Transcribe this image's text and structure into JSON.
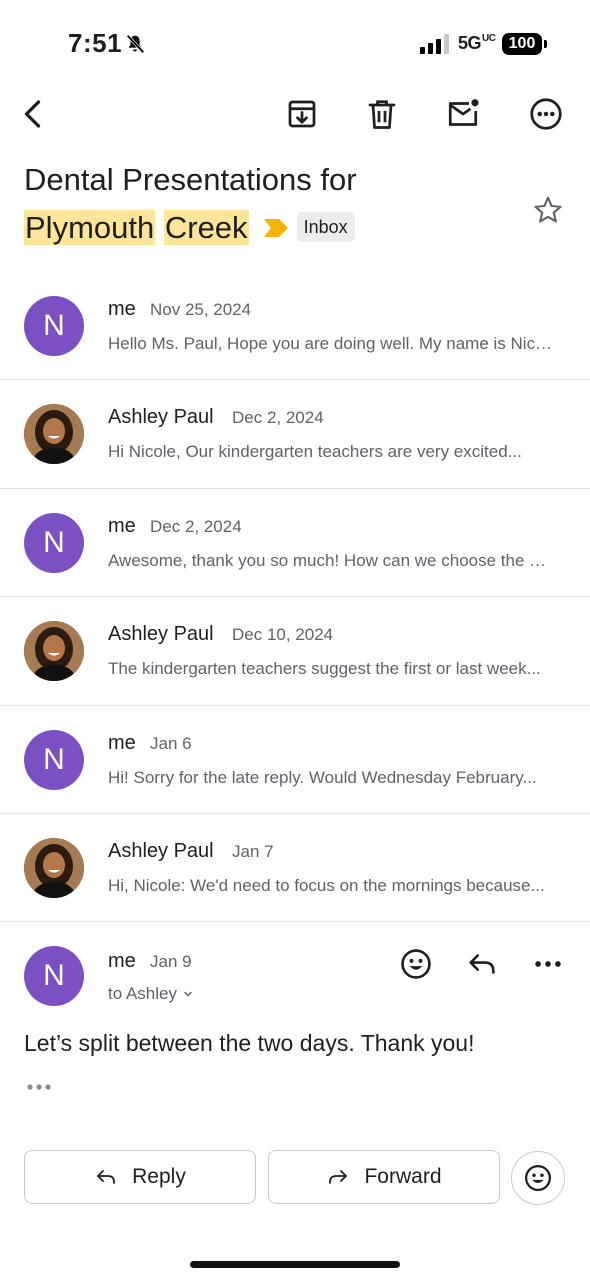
{
  "status": {
    "time": "7:51",
    "network": "5G",
    "network_suffix": "UC",
    "battery": "100"
  },
  "toolbar": {
    "back_icon": "chevron-left-icon",
    "archive_icon": "archive-icon",
    "delete_icon": "trash-icon",
    "mark_unread_icon": "mail-unread-icon",
    "more_icon": "more-horizontal-circle-icon"
  },
  "subject": {
    "line1": "Dental Presentations for",
    "highlight1": "Plymouth",
    "highlight2": "Creek",
    "label": "Inbox",
    "importance_color": "#f4b400",
    "highlight_color": "#fde59a"
  },
  "thread": [
    {
      "sender": "me",
      "date": "Nov 25, 2024",
      "snippet": "Hello Ms. Paul, Hope you are doing well. My name is Nicole...",
      "avatar": "N",
      "avatar_type": "letter"
    },
    {
      "sender": "Ashley Paul",
      "date": "Dec 2, 2024",
      "snippet": "Hi Nicole, Our kindergarten teachers are very excited...",
      "avatar": "",
      "avatar_type": "photo"
    },
    {
      "sender": "me",
      "date": "Dec 2, 2024",
      "snippet": "Awesome, thank you so much! How can we choose the dates...",
      "avatar": "N",
      "avatar_type": "letter"
    },
    {
      "sender": "Ashley Paul",
      "date": "Dec 10, 2024",
      "snippet": "The kindergarten teachers suggest the first or last week...",
      "avatar": "",
      "avatar_type": "photo"
    },
    {
      "sender": "me",
      "date": "Jan 6",
      "snippet": "Hi! Sorry for the late reply. Would Wednesday February...",
      "avatar": "N",
      "avatar_type": "letter"
    },
    {
      "sender": "Ashley Paul",
      "date": "Jan 7",
      "snippet": "Hi, Nicole: We'd need to focus on the mornings because...",
      "avatar": "",
      "avatar_type": "photo"
    }
  ],
  "expanded": {
    "sender": "me",
    "date": "Jan 9",
    "to": "to Ashley",
    "avatar": "N",
    "body": "Let’s split between the two days. Thank you!",
    "avatar_color": "#7a50c2"
  },
  "actions": {
    "reply": "Reply",
    "forward": "Forward"
  }
}
